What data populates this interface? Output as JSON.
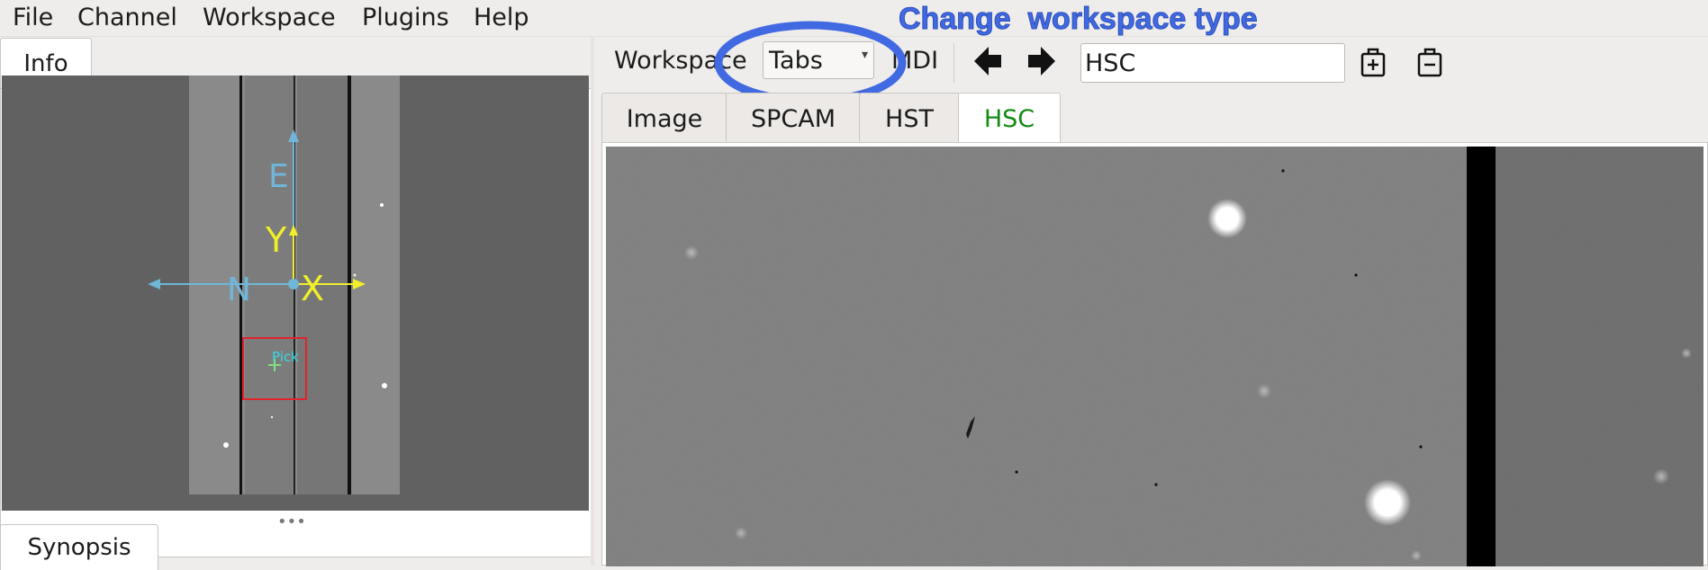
{
  "menu": {
    "items": [
      "File",
      "Channel",
      "Workspace",
      "Plugins",
      "Help"
    ]
  },
  "left_panel": {
    "info_tab": "Info",
    "synopsis_tab": "Synopsis",
    "splitter_handle": "•••",
    "thumbnail": {
      "compass_labels": {
        "east": "E",
        "north": "N",
        "y": "Y",
        "x": "X"
      },
      "pick_label": "Pick",
      "colors": {
        "compass": "#6fb6d8",
        "axes": "#f0ef2a",
        "pick_box": "#e1232b",
        "pick_text": "#36d9e6"
      }
    }
  },
  "toolbar": {
    "workspace_label": "Workspace",
    "workspace_type": "Tabs",
    "workspace_type_caret": "▾",
    "mdi_label": "MDI",
    "channel_name": "HSC",
    "icons": [
      "arrow-left-icon",
      "arrow-right-icon",
      "add-channel-icon",
      "delete-channel-icon"
    ]
  },
  "annotation": {
    "text": "Change  workspace type",
    "color": "#4169e1"
  },
  "channel_tabs": [
    {
      "label": "Image",
      "active": false
    },
    {
      "label": "SPCAM",
      "active": false
    },
    {
      "label": "HST",
      "active": false
    },
    {
      "label": "HSC",
      "active": true
    }
  ],
  "colors": {
    "active_tab_text": "#138a13",
    "window_bg": "#efedeb"
  }
}
